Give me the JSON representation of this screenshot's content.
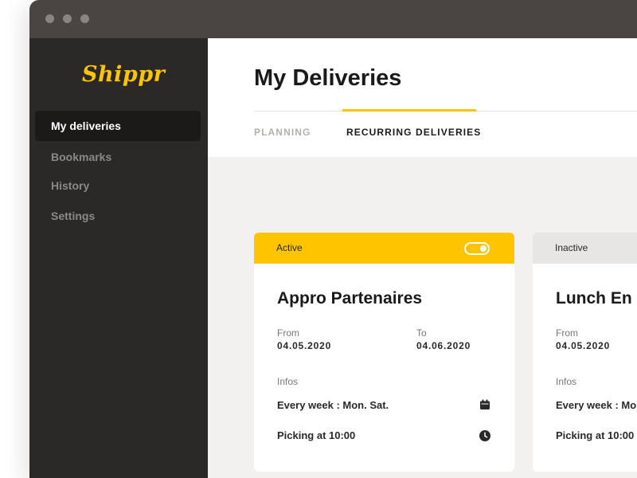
{
  "app": {
    "logo_text": "Shippr"
  },
  "sidebar": {
    "items": [
      {
        "label": "My deliveries",
        "active": true
      },
      {
        "label": "Bookmarks",
        "active": false
      },
      {
        "label": "History",
        "active": false
      },
      {
        "label": "Settings",
        "active": false
      }
    ]
  },
  "header": {
    "title": "My Deliveries",
    "tabs": [
      {
        "label": "PLANNING",
        "active": false
      },
      {
        "label": "RECURRING DELIVERIES",
        "active": true
      }
    ]
  },
  "cards": [
    {
      "status": "Active",
      "toggle_on": true,
      "title": "Appro Partenaires",
      "from_label": "From",
      "from_date": "04.05.2020",
      "to_label": "To",
      "to_date": "04.06.2020",
      "infos_label": "Infos",
      "schedule": "Every week : Mon. Sat.",
      "picking": "Picking at 10:00",
      "schedule_icon": "calendar-icon",
      "picking_icon": "clock-icon"
    },
    {
      "status": "Inactive",
      "toggle_on": false,
      "title": "Lunch En",
      "from_label": "From",
      "from_date": "04.05.2020",
      "infos_label": "Infos",
      "schedule": "Every week : Mo",
      "picking": "Picking at 10:00"
    }
  ],
  "colors": {
    "accent": "#ffc400",
    "sidebar_bg": "#2b2928",
    "titlebar_bg": "#4a4543",
    "content_bg": "#f2f1ef"
  }
}
